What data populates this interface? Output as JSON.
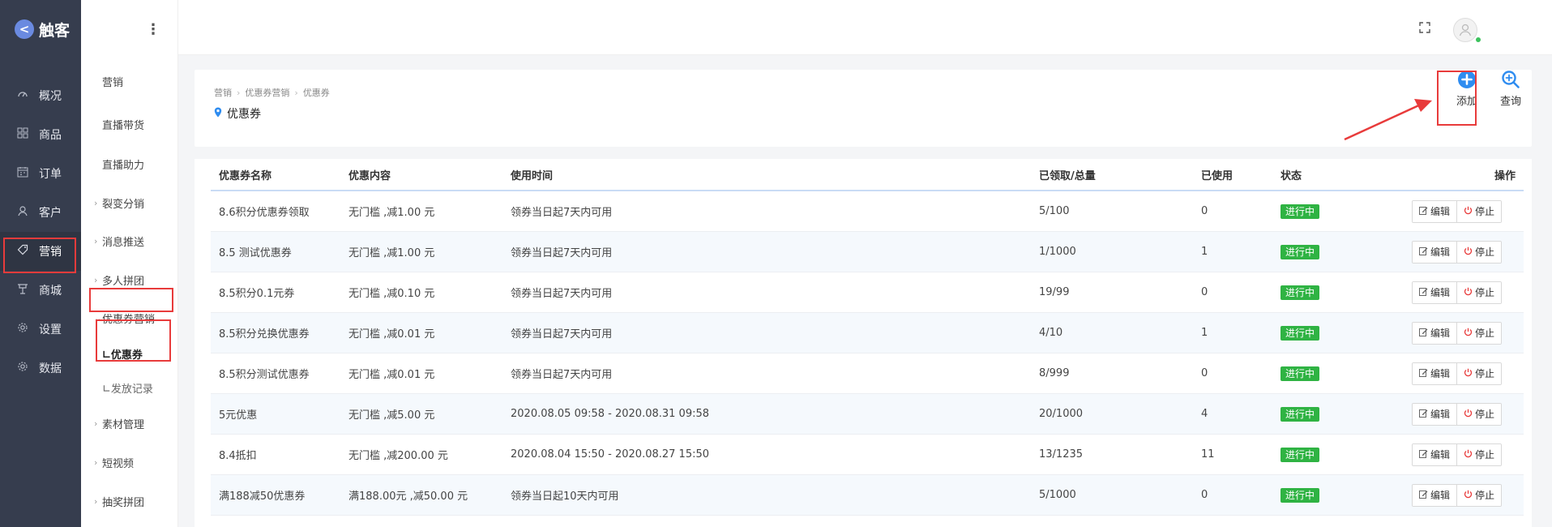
{
  "app": {
    "logo_letter": "<",
    "name": "触客"
  },
  "nav": {
    "items": [
      {
        "label": "概况",
        "icon": "dashboard-icon"
      },
      {
        "label": "商品",
        "icon": "grid-icon"
      },
      {
        "label": "订单",
        "icon": "calendar-icon"
      },
      {
        "label": "客户",
        "icon": "user-icon"
      },
      {
        "label": "营销",
        "icon": "tag-icon",
        "active": true
      },
      {
        "label": "商城",
        "icon": "store-icon"
      },
      {
        "label": "设置",
        "icon": "gear-icon"
      },
      {
        "label": "数据",
        "icon": "gear-icon"
      }
    ]
  },
  "submenu": {
    "toggle": "⋮",
    "items": [
      {
        "label": "营销"
      },
      {
        "label": "直播带货"
      },
      {
        "label": "直播助力"
      },
      {
        "label": "裂变分销",
        "caret": "›"
      },
      {
        "label": "消息推送",
        "caret": "›"
      },
      {
        "label": "多人拼团",
        "caret": "›"
      },
      {
        "label": "优惠券营销",
        "caret": "⌄"
      },
      {
        "label": "∟优惠券",
        "child": true,
        "active": true
      },
      {
        "label": "∟发放记录",
        "child": true
      },
      {
        "label": "素材管理",
        "caret": "›"
      },
      {
        "label": "短视频",
        "caret": "›"
      },
      {
        "label": "抽奖拼团",
        "caret": "›"
      }
    ]
  },
  "breadcrumb": [
    "营销",
    "优惠券营销",
    "优惠券"
  ],
  "page_title": "优惠券",
  "actions": {
    "add": "添加",
    "query": "查询"
  },
  "table": {
    "headers": {
      "name": "优惠券名称",
      "content": "优惠内容",
      "time": "使用时间",
      "count": "已领取/总量",
      "used": "已使用",
      "status": "状态",
      "ops": "操作"
    },
    "edit_label": "编辑",
    "stop_label": "停止",
    "rows": [
      {
        "name": "8.6积分优惠券领取",
        "content": "无门槛 ,减1.00 元",
        "time": "领券当日起7天内可用",
        "count": "5/100",
        "used": "0",
        "status": "进行中"
      },
      {
        "name": "8.5 测试优惠券",
        "content": "无门槛 ,减1.00 元",
        "time": "领券当日起7天内可用",
        "count": "1/1000",
        "used": "1",
        "status": "进行中"
      },
      {
        "name": "8.5积分0.1元券",
        "content": "无门槛 ,减0.10 元",
        "time": "领券当日起7天内可用",
        "count": "19/99",
        "used": "0",
        "status": "进行中"
      },
      {
        "name": "8.5积分兑换优惠券",
        "content": "无门槛 ,减0.01 元",
        "time": "领券当日起7天内可用",
        "count": "4/10",
        "used": "1",
        "status": "进行中"
      },
      {
        "name": "8.5积分测试优惠券",
        "content": "无门槛 ,减0.01 元",
        "time": "领券当日起7天内可用",
        "count": "8/999",
        "used": "0",
        "status": "进行中"
      },
      {
        "name": "5元优惠",
        "content": "无门槛 ,减5.00 元",
        "time": "2020.08.05 09:58 - 2020.08.31 09:58",
        "count": "20/1000",
        "used": "4",
        "status": "进行中"
      },
      {
        "name": "8.4抵扣",
        "content": "无门槛 ,减200.00 元",
        "time": "2020.08.04 15:50 - 2020.08.27 15:50",
        "count": "13/1235",
        "used": "11",
        "status": "进行中"
      },
      {
        "name": "满188减50优惠券",
        "content": "满188.00元 ,减50.00 元",
        "time": "领券当日起10天内可用",
        "count": "5/1000",
        "used": "0",
        "status": "进行中"
      }
    ]
  },
  "colors": {
    "nav_bg": "#363d4e",
    "accent": "#2e8cf0",
    "status_green": "#2fb343",
    "annotation_red": "#e83b3b"
  }
}
